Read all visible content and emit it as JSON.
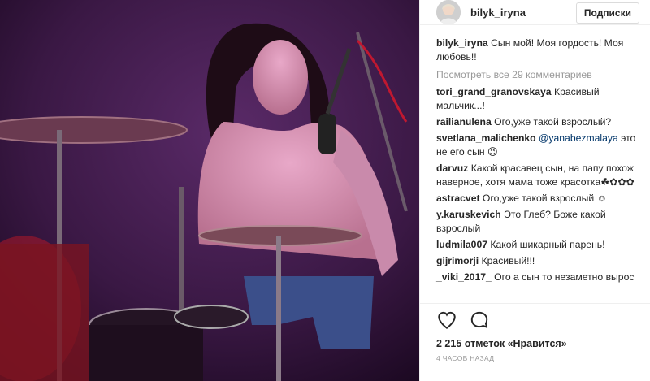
{
  "post": {
    "header": {
      "username": "bilyk_iryna",
      "follow_label": "Подписки"
    },
    "caption": {
      "author": "bilyk_iryna",
      "text": "Сын мой! Моя гордость! Моя любовь!!"
    },
    "view_all_comments": "Посмотреть все 29 комментариев",
    "comments": [
      {
        "author": "tori_grand_granovskaya",
        "text": "Красивый мальчик...!"
      },
      {
        "author": "railianulena",
        "text": "Ого,уже такой взрослый?"
      },
      {
        "author": "svetlana_malichenko",
        "mention": "@yanabezmalaya",
        "text": "это не его сын 😉"
      },
      {
        "author": "darvuz",
        "text": "Какой красавец сын, на папу похож наверное, хотя мама тоже красотка☘✿✿✿"
      },
      {
        "author": "astracvet",
        "text": "Ого,уже такой взрослый ☺"
      },
      {
        "author": "y.karuskevich",
        "text": "Это Глеб? Боже какой взрослый"
      },
      {
        "author": "ludmila007",
        "text": "Какой шикарный парень!"
      },
      {
        "author": "gijrimorji",
        "text": "Красивый!!!"
      },
      {
        "author": "_viki_2017_",
        "text": "Ого а сын то незаметно вырос"
      }
    ],
    "likes_text": "2 215 отметок «Нравится»",
    "time_text": "4 ЧАСОВ НАЗАД"
  },
  "icons": {
    "like": "heart-icon",
    "comment": "comment-bubble-icon"
  },
  "colors": {
    "photo_background": "#2a1030",
    "mention": "#003569",
    "muted": "#999999"
  }
}
